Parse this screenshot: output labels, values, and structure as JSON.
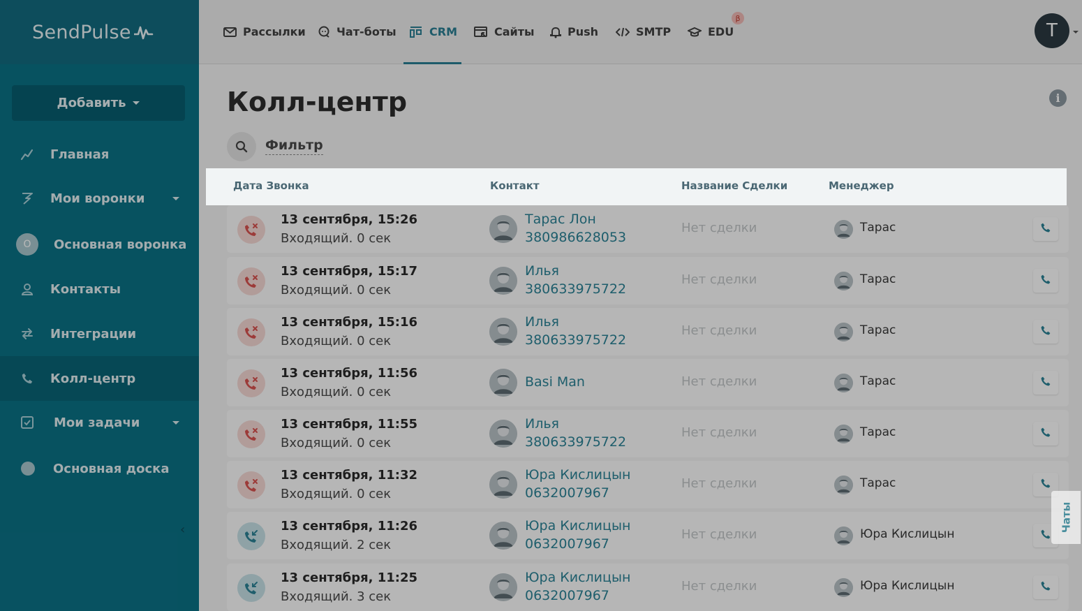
{
  "app": {
    "logo": "SendPulse"
  },
  "sidebar": {
    "add_label": "Добавить",
    "items": [
      {
        "label": "Главная",
        "icon": "chart-line-icon"
      },
      {
        "label": "Мои воронки",
        "icon": "funnel-icon"
      },
      {
        "label": "Основная воронка",
        "badge": "О"
      },
      {
        "label": "Контакты",
        "icon": "contacts-icon"
      },
      {
        "label": "Интеграции",
        "icon": "arrows-exchange-icon"
      },
      {
        "label": "Колл-центр",
        "icon": "phone-icon"
      },
      {
        "label": "Мои задачи",
        "icon": "checkbox-icon"
      },
      {
        "label": "Основная доска"
      }
    ]
  },
  "topnav": {
    "items": [
      {
        "label": "Рассылки",
        "icon": "envelope-icon"
      },
      {
        "label": "Чат-боты",
        "icon": "chat-bubble-icon"
      },
      {
        "label": "CRM",
        "icon": "crm-icon",
        "active": true
      },
      {
        "label": "Сайты",
        "icon": "site-icon"
      },
      {
        "label": "Push",
        "icon": "bell-icon"
      },
      {
        "label": "SMTP",
        "icon": "code-icon"
      },
      {
        "label": "EDU",
        "icon": "graduation-cap-icon"
      }
    ],
    "beta": "β",
    "avatar": "T"
  },
  "page": {
    "title": "Колл-центр",
    "filter": "Фильтр"
  },
  "table": {
    "headers": [
      "Дата Звонка",
      "Контакт",
      "Название Сделки",
      "Менеджер"
    ],
    "rows": [
      {
        "date": "13 сентября, 15:26",
        "sub": "Входящий. 0 сек",
        "contact": "Тарас Лон",
        "phone": "380986628053",
        "deal": "Нет сделки",
        "manager": "Тарас",
        "status": "missed"
      },
      {
        "date": "13 сентября, 15:17",
        "sub": "Входящий. 0 сек",
        "contact": "Илья",
        "phone": "380633975722",
        "deal": "Нет сделки",
        "manager": "Тарас",
        "status": "missed"
      },
      {
        "date": "13 сентября, 15:16",
        "sub": "Входящий. 0 сек",
        "contact": "Илья",
        "phone": "380633975722",
        "deal": "Нет сделки",
        "manager": "Тарас",
        "status": "missed"
      },
      {
        "date": "13 сентября, 11:56",
        "sub": "Входящий. 0 сек",
        "contact": "Basi Man",
        "phone": "",
        "deal": "Нет сделки",
        "manager": "Тарас",
        "status": "missed"
      },
      {
        "date": "13 сентября, 11:55",
        "sub": "Входящий. 0 сек",
        "contact": "Илья",
        "phone": "380633975722",
        "deal": "Нет сделки",
        "manager": "Тарас",
        "status": "missed"
      },
      {
        "date": "13 сентября, 11:32",
        "sub": "Входящий. 0 сек",
        "contact": "Юра Кислицын",
        "phone": "0632007967",
        "deal": "Нет сделки",
        "manager": "Тарас",
        "status": "missed"
      },
      {
        "date": "13 сентября, 11:26",
        "sub": "Входящий. 2 сек",
        "contact": "Юра Кислицын",
        "phone": "0632007967",
        "deal": "Нет сделки",
        "manager": "Юра Кислицын",
        "status": "answered"
      },
      {
        "date": "13 сентября, 11:25",
        "sub": "Входящий. 3 сек",
        "contact": "Юра Кислицын",
        "phone": "0632007967",
        "deal": "Нет сделки",
        "manager": "Юра Кислицын",
        "status": "answered"
      }
    ]
  },
  "chats_tab": "Чаты",
  "colors": {
    "sidebar": "#0b7286",
    "accent": "#2b8396",
    "missed": "#d9534f"
  }
}
